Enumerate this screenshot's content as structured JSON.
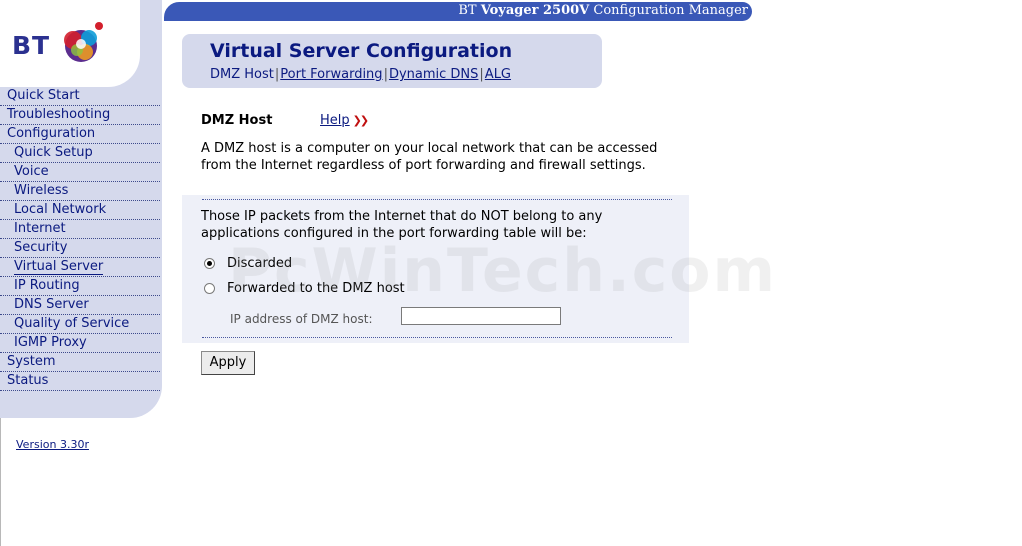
{
  "window": {
    "title_prefix": "BT ",
    "title_product": "Voyager 2500V",
    "title_suffix": " Configuration Manager"
  },
  "logo": {
    "text": "BT"
  },
  "sidebar": {
    "items": [
      {
        "label": "Quick Start",
        "level": "top"
      },
      {
        "label": "Troubleshooting",
        "level": "top"
      },
      {
        "label": "Configuration",
        "level": "top"
      },
      {
        "label": "Quick Setup",
        "level": "sub"
      },
      {
        "label": "Voice",
        "level": "sub"
      },
      {
        "label": "Wireless",
        "level": "sub"
      },
      {
        "label": "Local Network",
        "level": "sub"
      },
      {
        "label": "Internet",
        "level": "sub"
      },
      {
        "label": "Security",
        "level": "sub"
      },
      {
        "label": "Virtual Server",
        "level": "sub",
        "active": true
      },
      {
        "label": "IP Routing",
        "level": "sub"
      },
      {
        "label": "DNS Server",
        "level": "sub"
      },
      {
        "label": "Quality of Service",
        "level": "sub"
      },
      {
        "label": "IGMP Proxy",
        "level": "sub"
      },
      {
        "label": "System",
        "level": "top"
      },
      {
        "label": "Status",
        "level": "top"
      }
    ],
    "version": "Version 3.30r"
  },
  "header": {
    "title": "Virtual Server Configuration",
    "tabs": [
      {
        "label": "DMZ Host",
        "current": true
      },
      {
        "label": "Port Forwarding"
      },
      {
        "label": "Dynamic DNS"
      },
      {
        "label": "ALG"
      }
    ]
  },
  "content": {
    "section_title": "DMZ Host",
    "help_label": "Help",
    "help_icon": "double-chevron-right-icon",
    "description": "A DMZ host is a computer on your local network that can be accessed from the Internet regardless of port forwarding and firewall settings.",
    "panel_text": "Those IP packets from the Internet that do NOT belong to any applications configured in the port forwarding table will be:",
    "options": [
      {
        "label": "Discarded",
        "selected": true
      },
      {
        "label": "Forwarded to the DMZ host",
        "selected": false
      }
    ],
    "ip_label": "IP address of DMZ host:",
    "ip_value": "",
    "apply_label": "Apply"
  },
  "watermark": "PcWinTech.com",
  "colors": {
    "accent_blue": "#3a58b7",
    "nav_text": "#0b1a80",
    "sidebar_bg": "#d5d9ec",
    "panel_bg": "#eef0f8"
  }
}
